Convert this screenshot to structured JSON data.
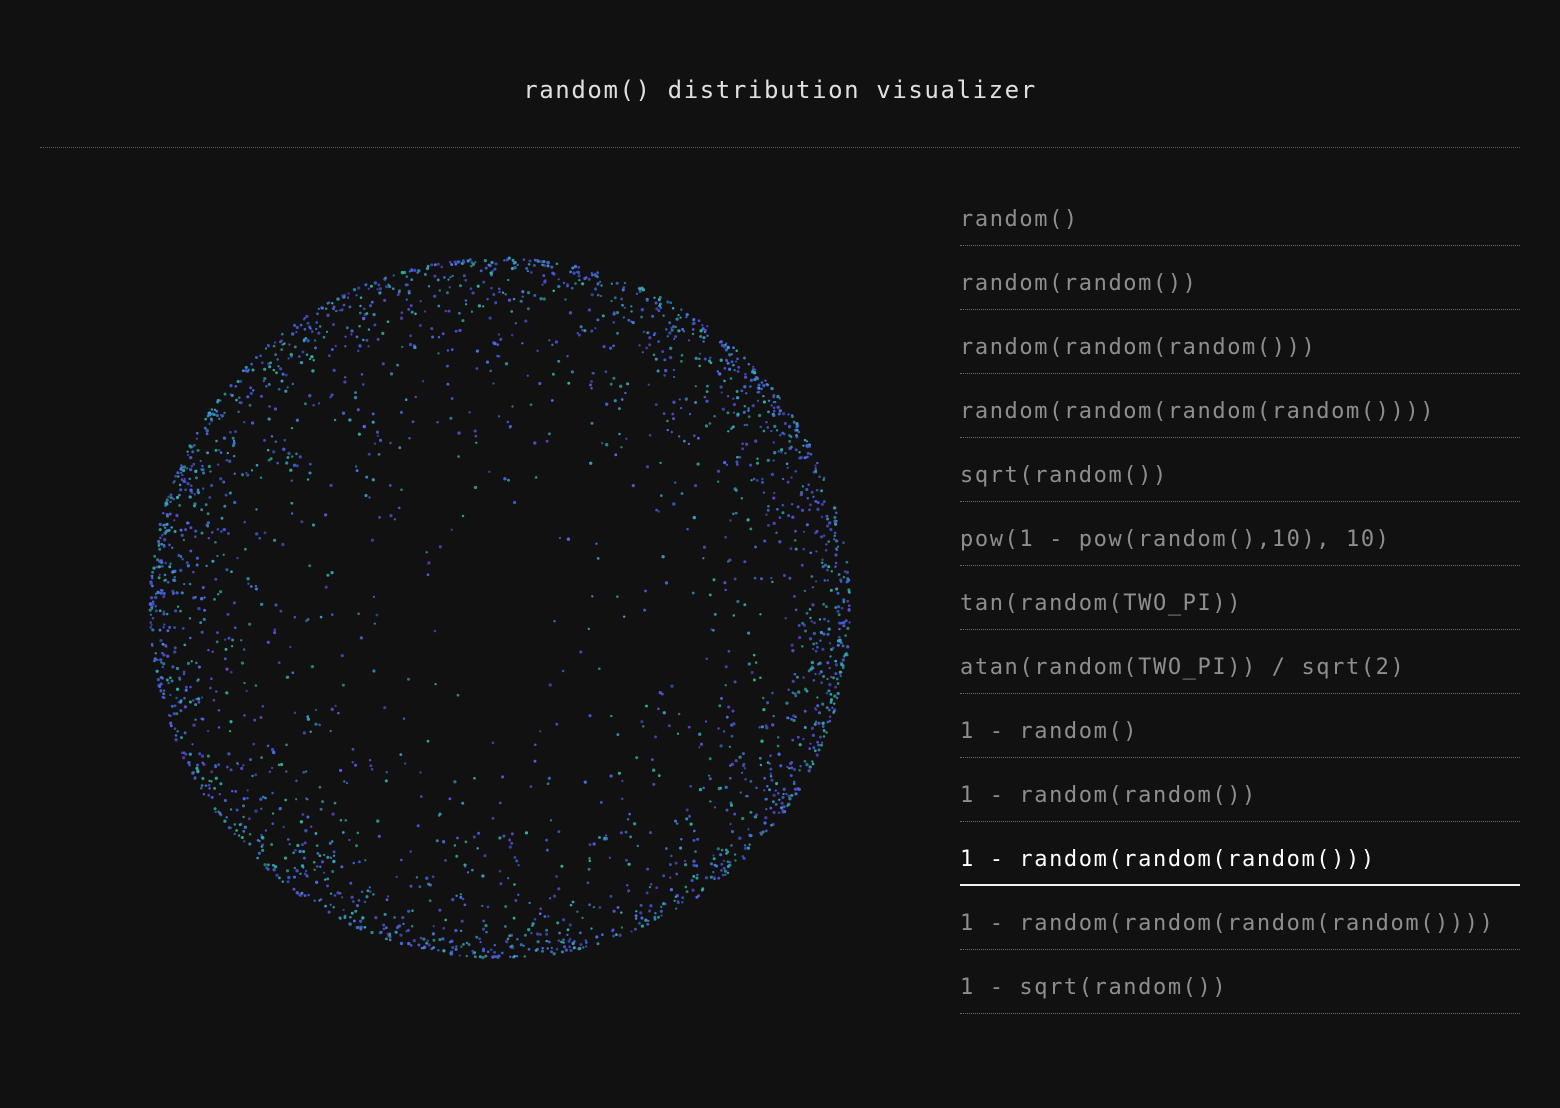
{
  "header": {
    "title": "random() distribution visualizer"
  },
  "visualizer": {
    "shape": "circle",
    "point_count": 2600,
    "selected_formula_index": 10,
    "point_colors": [
      "#3f5bd8",
      "#4a6ff0",
      "#3aa0c8",
      "#2fb39b",
      "#5b4fd6"
    ]
  },
  "menu": {
    "items": [
      {
        "label": "random()"
      },
      {
        "label": "random(random())"
      },
      {
        "label": "random(random(random()))"
      },
      {
        "label": "random(random(random(random())))"
      },
      {
        "label": "sqrt(random())"
      },
      {
        "label": "pow(1 - pow(random(),10), 10)"
      },
      {
        "label": "tan(random(TWO_PI))"
      },
      {
        "label": "atan(random(TWO_PI)) / sqrt(2)"
      },
      {
        "label": "1 - random()"
      },
      {
        "label": "1 - random(random())"
      },
      {
        "label": "1 - random(random(random()))"
      },
      {
        "label": "1 - random(random(random(random())))"
      },
      {
        "label": "1 - sqrt(random())"
      }
    ]
  }
}
